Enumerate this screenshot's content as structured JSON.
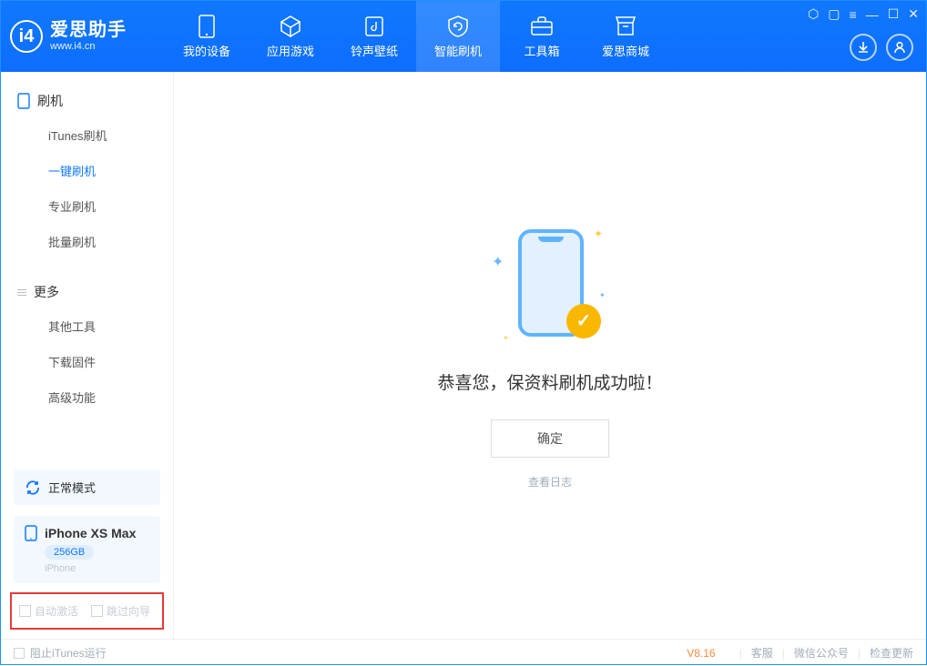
{
  "header": {
    "app_name": "爱思助手",
    "app_url": "www.i4.cn",
    "nav": [
      {
        "label": "我的设备",
        "icon": "phone-icon"
      },
      {
        "label": "应用游戏",
        "icon": "cube-icon"
      },
      {
        "label": "铃声壁纸",
        "icon": "music-icon"
      },
      {
        "label": "智能刷机",
        "icon": "refresh-shield-icon"
      },
      {
        "label": "工具箱",
        "icon": "toolbox-icon"
      },
      {
        "label": "爱思商城",
        "icon": "shop-icon"
      }
    ],
    "active_nav_index": 3
  },
  "sidebar": {
    "section1": {
      "heading": "刷机",
      "items": [
        "iTunes刷机",
        "一键刷机",
        "专业刷机",
        "批量刷机"
      ],
      "active_index": 1
    },
    "section2": {
      "heading": "更多",
      "items": [
        "其他工具",
        "下载固件",
        "高级功能"
      ]
    },
    "mode_label": "正常模式",
    "device": {
      "name": "iPhone XS Max",
      "capacity": "256GB",
      "type": "iPhone"
    },
    "opts": {
      "auto_activate": "自动激活",
      "skip_guide": "跳过向导"
    }
  },
  "main": {
    "success_msg": "恭喜您，保资料刷机成功啦！",
    "ok_btn": "确定",
    "view_log": "查看日志"
  },
  "footer": {
    "block_itunes": "阻止iTunes运行",
    "version": "V8.16",
    "links": [
      "客服",
      "微信公众号",
      "检查更新"
    ]
  }
}
